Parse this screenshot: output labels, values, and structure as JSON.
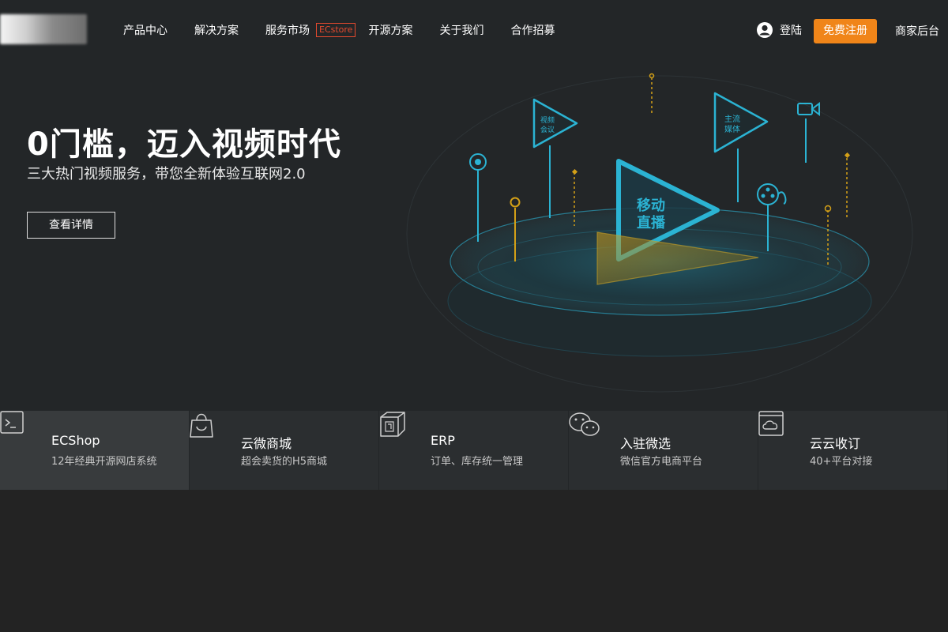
{
  "nav": {
    "items": [
      {
        "label": "产品中心"
      },
      {
        "label": "解决方案"
      },
      {
        "label": "服务市场",
        "badge": "ECstore"
      },
      {
        "label": "开源方案"
      },
      {
        "label": "关于我们"
      },
      {
        "label": "合作招募"
      }
    ],
    "login_label": "登陆",
    "register_label": "免费注册",
    "merchant_label": "商家后台"
  },
  "hero": {
    "title": "0门槛，迈入视频时代",
    "subtitle": "三大热门视频服务，带您全新体验互联网2.0",
    "cta_label": "查看详情",
    "art_labels": {
      "video_meeting": [
        "视频",
        "会议"
      ],
      "mainstream_media": [
        "主流",
        "媒体"
      ],
      "mobile_live": [
        "移动",
        "直播"
      ]
    }
  },
  "products": [
    {
      "name": "ECShop",
      "desc": "12年经典开源网店系统",
      "icon": "terminal-icon"
    },
    {
      "name": "云微商城",
      "desc": "超会卖货的H5商城",
      "icon": "shopping-bag-icon"
    },
    {
      "name": "ERP",
      "desc": "订单、库存统一管理",
      "icon": "cube-icon"
    },
    {
      "name": "入驻微选",
      "desc": "微信官方电商平台",
      "icon": "wechat-icon"
    },
    {
      "name": "云云收订",
      "desc": "40+平台对接",
      "icon": "cloud-box-icon"
    }
  ],
  "colors": {
    "accent_orange": "#f08519",
    "badge_red": "#e64a2e",
    "cyan": "#2bb3d3",
    "gold": "#d4a017"
  }
}
